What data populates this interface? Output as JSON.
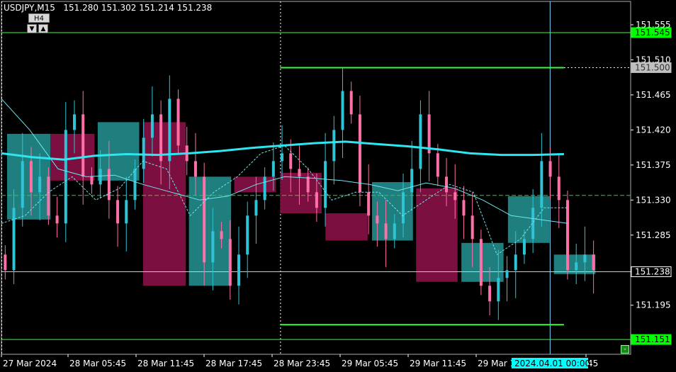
{
  "header": {
    "symbol_tf": "USDJPY,M15",
    "ohlc": "151.280 151.302 151.214 151.238"
  },
  "timeframe_badge": "H4",
  "arrow_down": "▼",
  "arrow_up": "▲",
  "corner_button": "-",
  "colors": {
    "background": "#000000",
    "grid": "#ffffff",
    "bull": "#2ec4d6",
    "bear": "#ff6fa8",
    "bull_box": "#1f7f7f",
    "bear_box": "#7a0f40",
    "ma_thick": "#2ee6f0",
    "ma_thin": "#6fe7ee",
    "level_green": "#33ff33",
    "dash_green": "#33cc33",
    "tag_green": "#00ff00",
    "tag_gray": "#c0c0c0",
    "tag_white": "#ffffff",
    "tag_cyan": "#00ffff"
  },
  "chart_data": {
    "type": "candlestick",
    "ylim": [
      151.132,
      151.585
    ],
    "y_ticks": [
      "151.555",
      "151.510",
      "151.465",
      "151.420",
      "151.375",
      "151.330",
      "151.285",
      "151.238",
      "151.195"
    ],
    "x_tick_labels": [
      "27 Mar 2024",
      "28 Mar 05:45",
      "28 Mar 11:45",
      "28 Mar 17:45",
      "28 Mar 23:45",
      "29 Mar 05:45",
      "29 Mar 11:45",
      "29 Mar 1",
      "45"
    ],
    "current_price": 151.238,
    "price_tags": [
      {
        "label": "151.545",
        "value": 151.545,
        "style": "green"
      },
      {
        "label": "151.500",
        "value": 151.5,
        "style": "gray"
      },
      {
        "label": "151.238",
        "value": 151.238,
        "style": "white"
      },
      {
        "label": "151.151",
        "value": 151.151,
        "style": "green"
      }
    ],
    "crosshair_label": "2024.04.01 00:00",
    "levels": [
      {
        "name": "hline-top",
        "value": 151.545,
        "x_frac": [
          0,
          1
        ]
      },
      {
        "name": "hline-bottom",
        "value": 151.151,
        "x_frac": [
          0,
          1
        ]
      },
      {
        "name": "hline-mid-dashed",
        "value": 151.336,
        "x_frac": [
          0,
          1
        ],
        "dashed": true
      },
      {
        "name": "hline-current",
        "value": 151.238,
        "x_frac": [
          0,
          1
        ]
      },
      {
        "name": "hline-upper-range",
        "value": 151.5,
        "x_frac": [
          0.443,
          0.894
        ]
      },
      {
        "name": "hline-lower-range",
        "value": 151.17,
        "x_frac": [
          0.443,
          0.894
        ]
      }
    ],
    "h4_boxes": [
      {
        "open": 151.305,
        "close": 151.415,
        "x_frac": [
          0.009,
          0.078
        ]
      },
      {
        "open": 151.415,
        "close": 151.355,
        "x_frac": [
          0.078,
          0.148
        ]
      },
      {
        "open": 151.355,
        "close": 151.43,
        "x_frac": [
          0.153,
          0.219
        ]
      },
      {
        "open": 151.43,
        "close": 151.22,
        "x_frac": [
          0.225,
          0.293
        ]
      },
      {
        "open": 151.22,
        "close": 151.36,
        "x_frac": [
          0.298,
          0.365
        ]
      },
      {
        "open": 151.36,
        "close": 151.34,
        "x_frac": [
          0.37,
          0.436
        ]
      },
      {
        "open": 151.365,
        "close": 151.313,
        "x_frac": [
          0.443,
          0.509
        ]
      },
      {
        "open": 151.313,
        "close": 151.278,
        "x_frac": [
          0.515,
          0.582
        ]
      },
      {
        "open": 151.278,
        "close": 151.353,
        "x_frac": [
          0.589,
          0.654
        ]
      },
      {
        "open": 151.345,
        "close": 151.225,
        "x_frac": [
          0.659,
          0.725
        ]
      },
      {
        "open": 151.225,
        "close": 151.275,
        "x_frac": [
          0.731,
          0.798
        ]
      },
      {
        "open": 151.275,
        "close": 151.335,
        "x_frac": [
          0.805,
          0.871
        ]
      },
      {
        "open": 151.235,
        "close": 151.26,
        "x_frac": [
          0.878,
          0.944
        ]
      }
    ],
    "ma_slow": [
      151.39,
      151.385,
      151.382,
      151.387,
      151.389,
      151.388,
      151.39,
      151.393,
      151.397,
      151.4,
      151.403,
      151.405,
      151.402,
      151.399,
      151.395,
      151.39,
      151.388,
      151.388,
      151.389
    ],
    "ma_fast": [
      151.46,
      151.42,
      151.37,
      151.36,
      151.362,
      151.35,
      151.34,
      151.33,
      151.335,
      151.35,
      151.36,
      151.358,
      151.355,
      151.35,
      151.342,
      151.352,
      151.345,
      151.33,
      151.31,
      151.305,
      151.3
    ],
    "ma_dashed": [
      151.3,
      151.31,
      151.34,
      151.36,
      151.33,
      151.345,
      151.38,
      151.37,
      151.31,
      151.34,
      151.36,
      151.39,
      151.4,
      151.37,
      151.33,
      151.34,
      151.34,
      151.31,
      151.33,
      151.35,
      151.34,
      151.26,
      151.28,
      151.32,
      151.32
    ],
    "candle_closes": [
      151.24,
      151.32,
      151.38,
      151.34,
      151.36,
      151.31,
      151.3,
      151.42,
      151.44,
      151.36,
      151.35,
      151.37,
      151.33,
      151.3,
      151.33,
      151.37,
      151.41,
      151.44,
      151.38,
      151.46,
      151.4,
      151.38,
      151.36,
      151.25,
      151.29,
      151.28,
      151.22,
      151.26,
      151.31,
      151.33,
      151.36,
      151.38,
      151.39,
      151.37,
      151.36,
      151.34,
      151.32,
      151.38,
      151.42,
      151.47,
      151.44,
      151.34,
      151.31,
      151.3,
      151.28,
      151.3,
      151.34,
      151.37,
      151.44,
      151.39,
      151.36,
      151.34,
      151.33,
      151.31,
      151.28,
      151.22,
      151.2,
      151.23,
      151.24,
      151.26,
      151.28,
      151.32,
      151.38,
      151.36,
      151.33,
      151.24,
      151.25,
      151.26,
      151.24
    ]
  }
}
